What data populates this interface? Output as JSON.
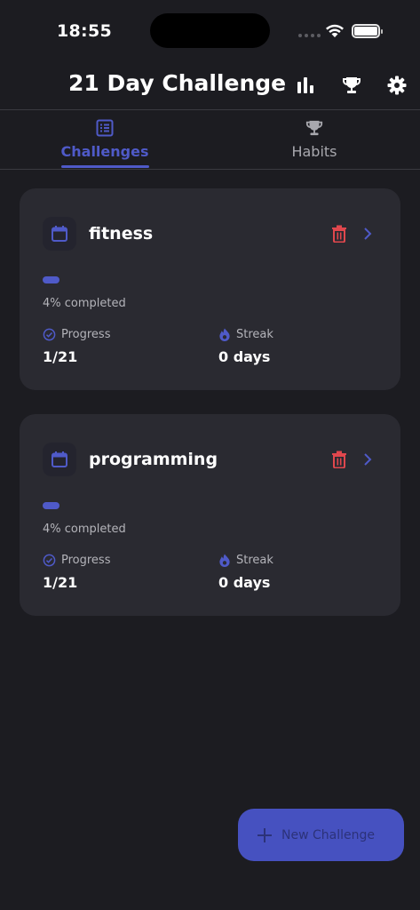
{
  "status_bar": {
    "time": "18:55"
  },
  "header": {
    "title": "21 Day Challenge",
    "icons": [
      "bar-chart-icon",
      "trophy-icon",
      "gear-icon"
    ]
  },
  "tabs": [
    {
      "label": "Challenges",
      "icon": "list-icon",
      "active": true
    },
    {
      "label": "Habits",
      "icon": "trophy-icon",
      "active": false
    }
  ],
  "challenges": [
    {
      "name": "fitness",
      "progress_fraction": 0.04,
      "percent_text": "4% completed",
      "progress_label": "Progress",
      "progress_value": "1/21",
      "streak_label": "Streak",
      "streak_value": "0 days"
    },
    {
      "name": "programming",
      "progress_fraction": 0.04,
      "percent_text": "4% completed",
      "progress_label": "Progress",
      "progress_value": "1/21",
      "streak_label": "Streak",
      "streak_value": "0 days"
    }
  ],
  "fab": {
    "label": "New Challenge",
    "icon": "plus-icon"
  },
  "colors": {
    "background": "#1c1c21",
    "card": "#2a2a31",
    "accent": "#4f5ac8",
    "danger": "#e0474d",
    "muted_text": "#b4b4ba"
  }
}
